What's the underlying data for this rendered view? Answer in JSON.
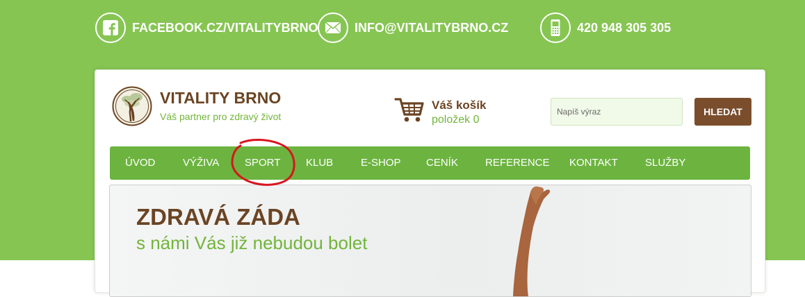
{
  "contacts": {
    "facebook": "FACEBOOK.CZ/VITALITYBRNO",
    "email": "INFO@VITALITYBRNO.CZ",
    "phone": "420 948 305 305"
  },
  "header": {
    "title": "VITALITY BRNO",
    "tagline": "Váš partner pro zdravý život"
  },
  "cart": {
    "title": "Váš košík",
    "count": "položek 0"
  },
  "search": {
    "placeholder": "Napíš výraz",
    "button_label": "HLEDAT"
  },
  "nav": {
    "items": [
      {
        "label": "ÚVOD"
      },
      {
        "label": "VÝŽIVA"
      },
      {
        "label": "SPORT"
      },
      {
        "label": "KLUB"
      },
      {
        "label": "E-SHOP"
      },
      {
        "label": "CENÍK"
      },
      {
        "label": "REFERENCE"
      },
      {
        "label": "KONTAKT"
      },
      {
        "label": "SLUŽBY"
      }
    ]
  },
  "hero": {
    "title": "ZDRAVÁ ZÁDA",
    "subtitle": "s námi Vás již nebudou bolet"
  },
  "colors": {
    "brand_green": "#86c552",
    "nav_green": "#6cb43f",
    "brown": "#6b4423",
    "accent_green": "#72b43a",
    "button_brown": "#7a4e2d",
    "annotation_red": "#d9141e"
  },
  "icons": [
    "facebook-icon",
    "envelope-icon",
    "phone-icon",
    "cart-icon",
    "tree-logo"
  ]
}
